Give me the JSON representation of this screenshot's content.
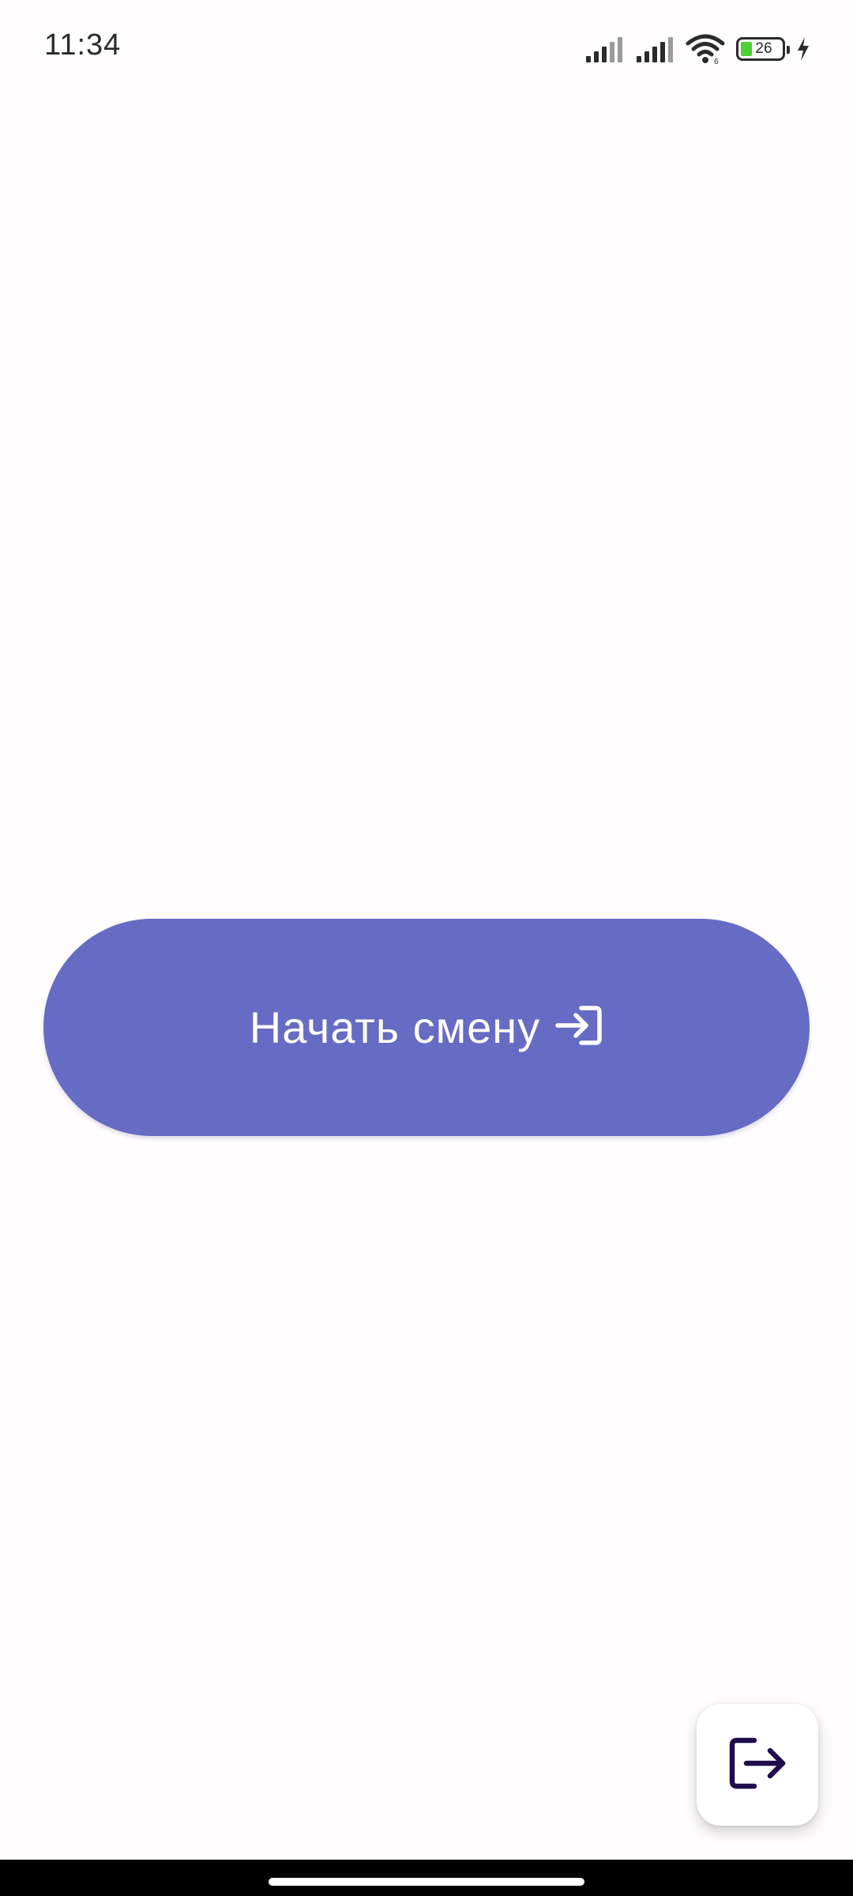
{
  "status_bar": {
    "time": "11:34",
    "battery_level": "26",
    "icons": [
      "signal-icon",
      "signal-icon",
      "wifi-icon",
      "battery-icon",
      "charging-icon"
    ]
  },
  "main": {
    "start_button_label": "Начать смену",
    "start_button_icon": "login-icon",
    "start_button_color": "#666bc3"
  },
  "fab": {
    "icon": "logout-icon",
    "icon_color": "#1f0b4d"
  }
}
